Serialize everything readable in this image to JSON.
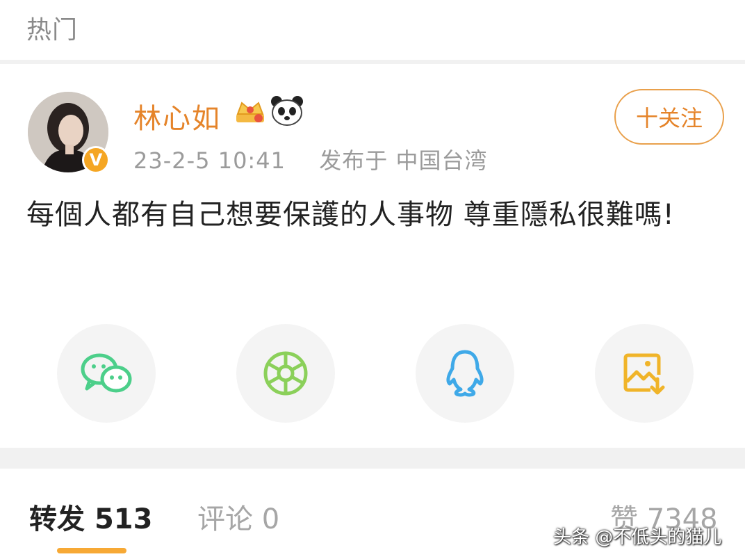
{
  "top_tab": {
    "label": "热门"
  },
  "post": {
    "author": {
      "name": "林心如",
      "avatar_icon": "avatar-photo",
      "verify_badge": "V",
      "badges": [
        "crown-icon",
        "panda-icon"
      ]
    },
    "meta": {
      "time": "23-2-5 10:41",
      "location": "发布于 中国台湾"
    },
    "follow_label": "十关注",
    "text": "每個人都有自己想要保護的人事物 尊重隱私很難嗎!",
    "share": [
      {
        "name": "wechat-icon",
        "color": "#4ccf8a"
      },
      {
        "name": "moments-icon",
        "color": "#8bd05a"
      },
      {
        "name": "qq-icon",
        "color": "#3fa9e8"
      },
      {
        "name": "save-image-icon",
        "color": "#f0b429"
      }
    ]
  },
  "stats": {
    "repost_label": "转发",
    "repost_count": "513",
    "comment_label": "评论",
    "comment_count": "0",
    "like_label": "赞",
    "like_count": "7348"
  },
  "watermark": "头条 @不低头的猫儿",
  "colors": {
    "accent": "#e5842a",
    "active_underline": "#f7a935"
  }
}
